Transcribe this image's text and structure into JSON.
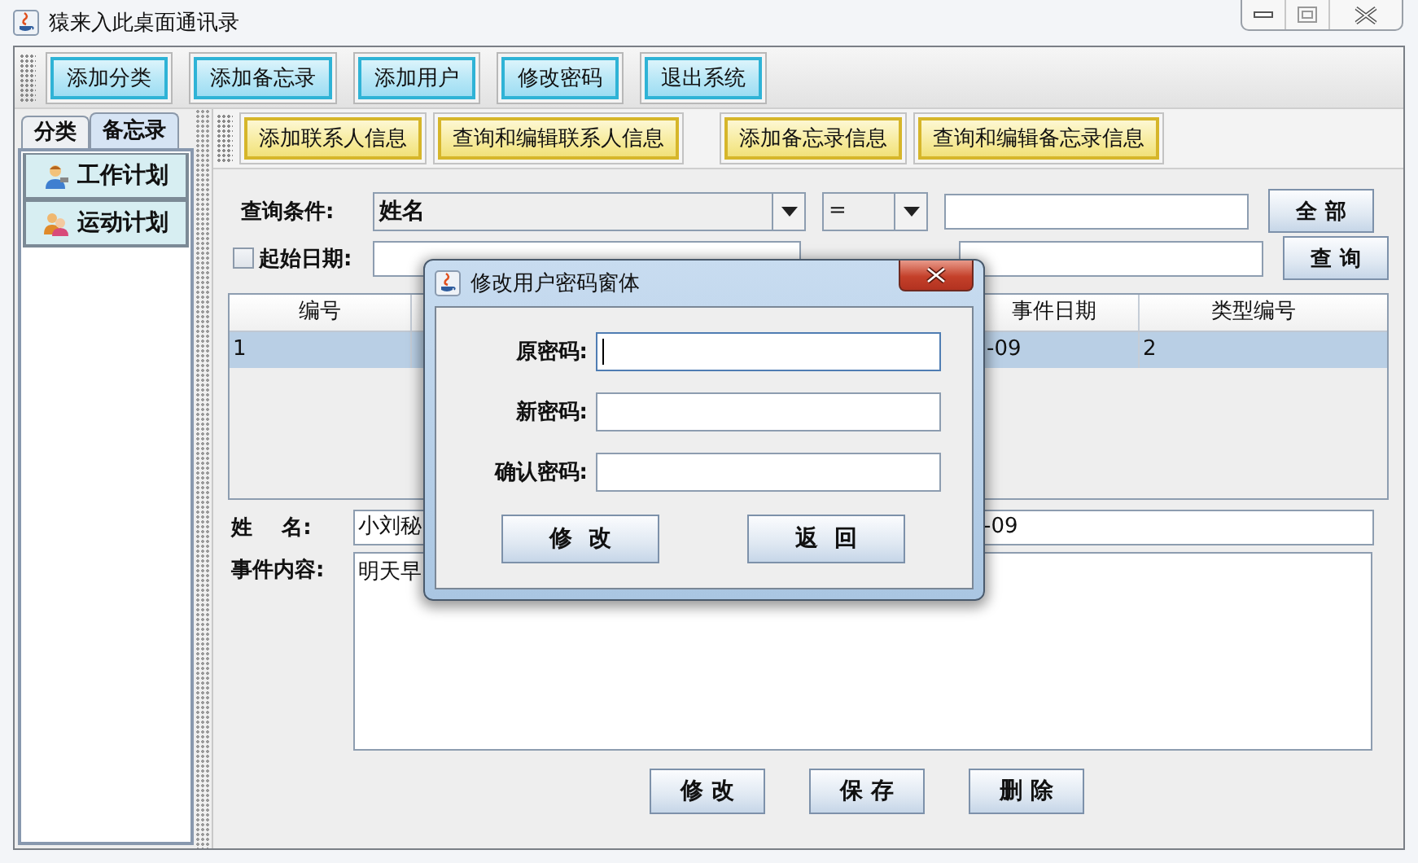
{
  "window": {
    "title": "猿来入此桌面通讯录"
  },
  "toolbar": [
    "添加分类",
    "添加备忘录",
    "添加用户",
    "修改密码",
    "退出系统"
  ],
  "side_tabs": [
    {
      "label": "分类",
      "selected": false
    },
    {
      "label": "备忘录",
      "selected": true
    }
  ],
  "side_items": [
    {
      "label": "工作计划",
      "kind": "worker"
    },
    {
      "label": "运动计划",
      "kind": "group"
    }
  ],
  "sub_toolbar": [
    "添加联系人信息",
    "查询和编辑联系人信息",
    "添加备忘录信息",
    "查询和编辑备忘录信息"
  ],
  "query": {
    "condition_label": "查询条件:",
    "field": "姓名",
    "operator": "=",
    "all_button": "全 部",
    "start_date": {
      "label": "起始日期:",
      "checked": false
    },
    "query_button": "查 询"
  },
  "table": {
    "columns": [
      "编号",
      "事件日期",
      "类型编号"
    ],
    "rows": [
      {
        "cells": [
          "1",
          "-09",
          "2"
        ],
        "selected": true
      }
    ]
  },
  "detail": {
    "name_label": "姓    名:",
    "name_value": "小刘秘",
    "date_value": "-09",
    "content_label": "事件内容:",
    "content_value": "明天早"
  },
  "actions": [
    "修 改",
    "保 存",
    "删 除"
  ],
  "dialog": {
    "title": "修改用户密码窗体",
    "fields": [
      {
        "label": "原密码:",
        "focused": true
      },
      {
        "label": "新密码:",
        "focused": false
      },
      {
        "label": "确认密码:",
        "focused": false
      }
    ],
    "buttons": [
      "修  改",
      "返  回"
    ]
  }
}
